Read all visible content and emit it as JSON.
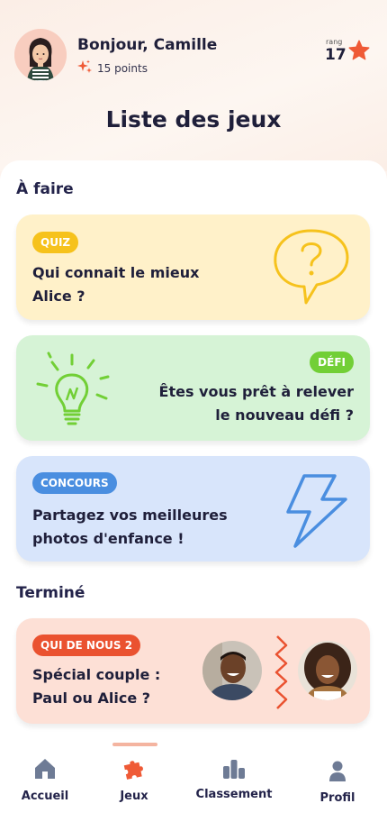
{
  "header": {
    "greeting": "Bonjour, Camille",
    "points": "15 points",
    "rank_label": "rang",
    "rank_value": "17",
    "page_title": "Liste des jeux"
  },
  "sections": {
    "todo": "À faire",
    "done": "Terminé"
  },
  "cards": [
    {
      "badge": "QUIZ",
      "line1": "Qui connait le mieux",
      "line2": "Alice ?",
      "color": "#fff1c9",
      "badge_color": "#f6c21c",
      "icon": "speech-bubble-question-icon"
    },
    {
      "badge": "DÉFI",
      "line1": "Êtes vous prêt à relever",
      "line2": "le nouveau défi ?",
      "color": "#d6f3d6",
      "badge_color": "#72cf36",
      "icon": "lightbulb-icon"
    },
    {
      "badge": "CONCOURS",
      "line1": "Partagez vos meilleures",
      "line2": "photos d'enfance !",
      "color": "#d8e5fb",
      "badge_color": "#4a8ee0",
      "icon": "lightning-icon"
    },
    {
      "badge": "QUI DE NOUS 2",
      "line1": "Spécial couple :",
      "line2": "Paul ou Alice ?",
      "color": "#fde0d6",
      "badge_color": "#ea5230",
      "icon": "zigzag-icon"
    }
  ],
  "nav": {
    "items": [
      {
        "label": "Accueil",
        "icon": "home-icon"
      },
      {
        "label": "Jeux",
        "icon": "puzzle-icon"
      },
      {
        "label": "Classement",
        "icon": "leaderboard-icon"
      },
      {
        "label": "Profil",
        "icon": "profile-icon"
      }
    ],
    "active": "Jeux"
  },
  "colors": {
    "accent": "#ef5a36",
    "text": "#1f1f3a",
    "nav_icon": "#6e7b95"
  }
}
